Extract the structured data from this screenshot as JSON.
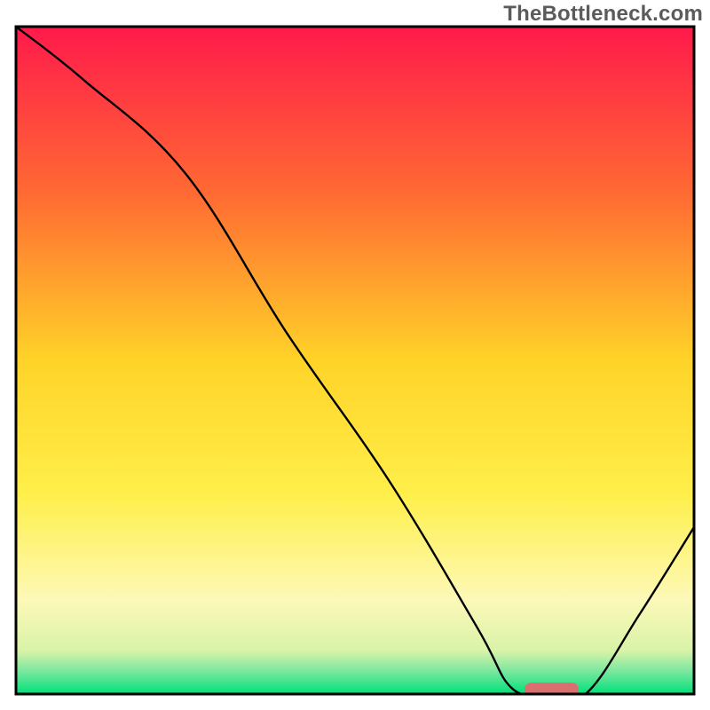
{
  "watermark": "TheBottleneck.com",
  "chart_data": {
    "type": "line",
    "title": "",
    "xlabel": "",
    "ylabel": "",
    "xlim": [
      0,
      100
    ],
    "ylim": [
      0,
      100
    ],
    "grid": false,
    "legend": false,
    "background_gradient": {
      "direction": "vertical",
      "stops": [
        {
          "pos": 0.0,
          "color": "#ff1a4b"
        },
        {
          "pos": 0.25,
          "color": "#ff6a33"
        },
        {
          "pos": 0.5,
          "color": "#ffd328"
        },
        {
          "pos": 0.7,
          "color": "#ffef4a"
        },
        {
          "pos": 0.86,
          "color": "#fdf9b8"
        },
        {
          "pos": 0.935,
          "color": "#d9f3a8"
        },
        {
          "pos": 0.965,
          "color": "#7de8a0"
        },
        {
          "pos": 1.0,
          "color": "#00e07a"
        }
      ]
    },
    "series": [
      {
        "name": "bottleneck-curve",
        "color": "#000000",
        "x": [
          0,
          10,
          25,
          40,
          55,
          68,
          73,
          78,
          84,
          92,
          100
        ],
        "values": [
          100,
          92,
          78,
          54,
          32,
          10,
          1,
          0,
          0,
          12,
          25
        ]
      }
    ],
    "marker": {
      "name": "optimal-range",
      "shape": "pill",
      "color": "#d9706f",
      "x_start": 75,
      "x_end": 83,
      "y": 0.7,
      "height": 2.0
    },
    "frame_color": "#000000"
  }
}
